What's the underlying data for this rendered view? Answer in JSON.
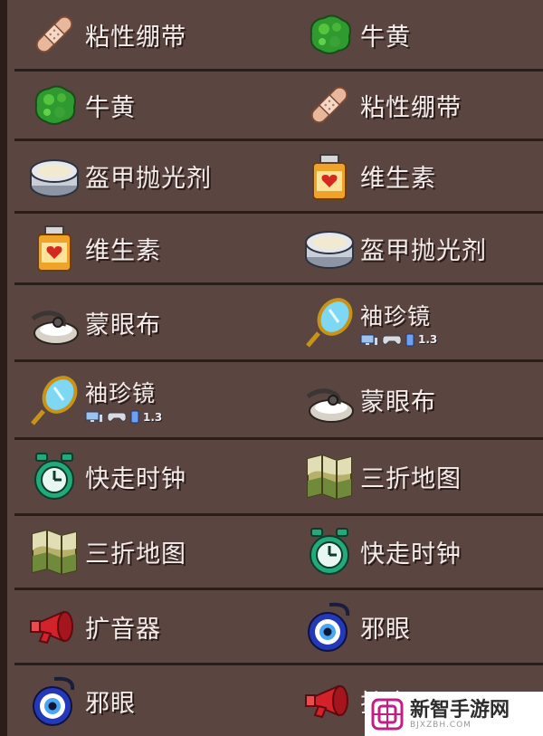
{
  "rows": [
    {
      "left": {
        "icon": "bandage-icon",
        "label": "粘性绷带"
      },
      "right": {
        "icon": "bezoar-icon",
        "label": "牛黄"
      }
    },
    {
      "left": {
        "icon": "bezoar-icon",
        "label": "牛黄"
      },
      "right": {
        "icon": "bandage-icon",
        "label": "粘性绷带"
      }
    },
    {
      "left": {
        "icon": "nail-polish-icon",
        "label": "盔甲抛光剂"
      },
      "right": {
        "icon": "vitamins-icon",
        "label": "维生素"
      }
    },
    {
      "left": {
        "icon": "vitamins-icon",
        "label": "维生素"
      },
      "right": {
        "icon": "nail-polish-icon",
        "label": "盔甲抛光剂"
      }
    },
    {
      "left": {
        "icon": "blindfold-icon",
        "label": "蒙眼布"
      },
      "right": {
        "icon": "pocket-mirror-icon",
        "label": "袖珍镜",
        "version": "1.3"
      }
    },
    {
      "left": {
        "icon": "pocket-mirror-icon",
        "label": "袖珍镜",
        "version": "1.3"
      },
      "right": {
        "icon": "blindfold-icon",
        "label": "蒙眼布"
      }
    },
    {
      "left": {
        "icon": "fast-clock-icon",
        "label": "快走时钟"
      },
      "right": {
        "icon": "trifold-map-icon",
        "label": "三折地图"
      }
    },
    {
      "left": {
        "icon": "trifold-map-icon",
        "label": "三折地图"
      },
      "right": {
        "icon": "fast-clock-icon",
        "label": "快走时钟"
      }
    },
    {
      "left": {
        "icon": "megaphone-icon",
        "label": "扩音器"
      },
      "right": {
        "icon": "evil-eye-icon",
        "label": "邪眼"
      }
    },
    {
      "left": {
        "icon": "evil-eye-icon",
        "label": "邪眼"
      },
      "right": {
        "icon": "megaphone-icon",
        "label": "扩音器"
      }
    }
  ],
  "watermark": {
    "title": "新智手游网",
    "subtitle": "BJXZBH.COM",
    "logo": "watermark-logo-icon"
  },
  "colors": {
    "background": "#5a4541",
    "divider": "#2b1d1a",
    "text": "#f3ecea"
  }
}
